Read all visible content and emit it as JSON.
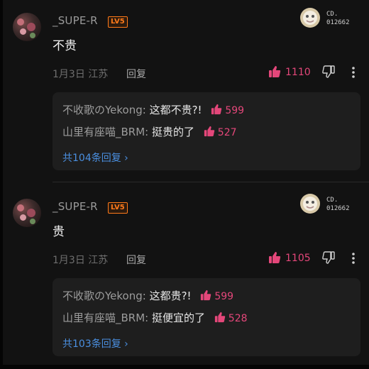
{
  "comments": [
    {
      "username": "_SUPE-R",
      "level_badge": "LV5",
      "medal_text": "CD.\n012662",
      "content": "不贵",
      "date": "1月3日",
      "location": "江苏",
      "reply_label": "回复",
      "like_count": "1110",
      "replies": [
        {
          "name": "不收歌のYekong:",
          "text": " 这都不贵?!",
          "likes": "599"
        },
        {
          "name": "山里有座喵_BRM:",
          "text": " 挺贵的了",
          "likes": "527"
        }
      ],
      "more_replies": "共104条回复 ›"
    },
    {
      "username": "_SUPE-R",
      "level_badge": "LV5",
      "medal_text": "CD.\n012662",
      "content": "贵",
      "date": "1月3日",
      "location": "江苏",
      "reply_label": "回复",
      "like_count": "1105",
      "replies": [
        {
          "name": "不收歌のYekong:",
          "text": " 这都贵?!",
          "likes": "599"
        },
        {
          "name": "山里有座喵_BRM:",
          "text": " 挺便宜的了",
          "likes": "528"
        }
      ],
      "more_replies": "共103条回复 ›"
    }
  ],
  "colors": {
    "like_pink": "#e4477a",
    "link_blue": "#4a8fe0",
    "badge_orange": "#ff7a1a"
  },
  "icons": [
    "thumbs-up-icon",
    "thumbs-down-icon",
    "more-vertical-icon",
    "fan-medal-icon"
  ]
}
